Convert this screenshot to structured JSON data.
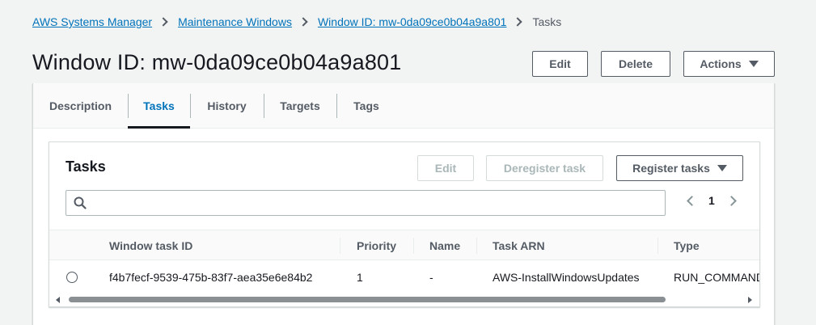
{
  "breadcrumb": {
    "items": [
      "AWS Systems Manager",
      "Maintenance Windows",
      "Window ID: mw-0da09ce0b04a9a801"
    ],
    "current": "Tasks"
  },
  "page": {
    "title": "Window ID: mw-0da09ce0b04a9a801",
    "edit_label": "Edit",
    "delete_label": "Delete",
    "actions_label": "Actions"
  },
  "tabs": [
    {
      "label": "Description",
      "active": false
    },
    {
      "label": "Tasks",
      "active": true
    },
    {
      "label": "History",
      "active": false
    },
    {
      "label": "Targets",
      "active": false
    },
    {
      "label": "Tags",
      "active": false
    }
  ],
  "tasks": {
    "title": "Tasks",
    "edit_label": "Edit",
    "deregister_label": "Deregister task",
    "register_label": "Register tasks",
    "search": {
      "value": "",
      "placeholder": ""
    },
    "pagination": {
      "current_page": "1"
    },
    "columns": [
      "Window task ID",
      "Priority",
      "Name",
      "Task ARN",
      "Type"
    ],
    "rows": [
      {
        "window_task_id": "f4b7fecf-9539-475b-83f7-aea35e6e84b2",
        "priority": "1",
        "name": "-",
        "task_arn": "AWS-InstallWindowsUpdates",
        "type": "RUN_COMMAND"
      }
    ]
  },
  "colors": {
    "link": "#0073bb",
    "text": "#16191f",
    "muted": "#545b64",
    "disabled": "#aab7b8",
    "background": "#f2f3f3"
  }
}
